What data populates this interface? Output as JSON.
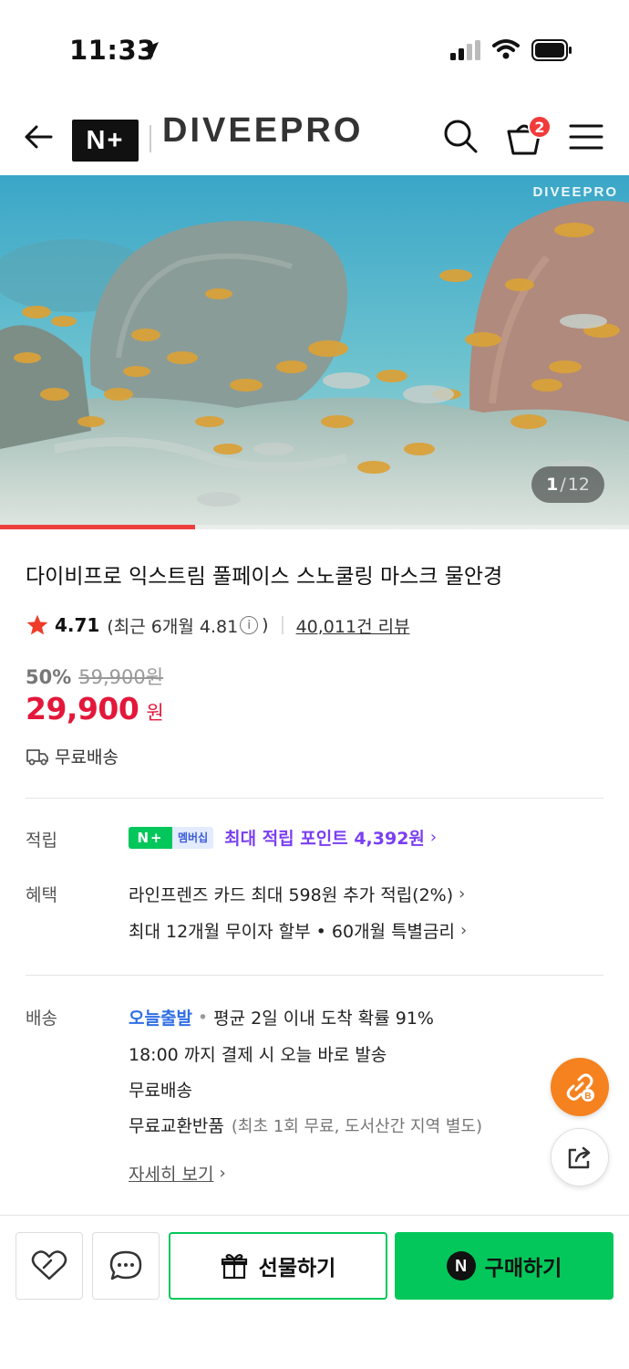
{
  "status_bar": {
    "time": "11:33"
  },
  "header": {
    "nplus_logo": "N+",
    "brand": "DIVEEPRO",
    "cart_count": "2"
  },
  "hero": {
    "watermark": "DIVEEPRO",
    "current_index": "1",
    "total_separator": "/",
    "total": "12",
    "progress_fraction": 0.31
  },
  "product": {
    "title": "다이비프로 익스트림 풀페이스 스노쿨링 마스크 물안경",
    "rating": "4.71",
    "recent_rating_prefix": "(최근 6개월 4.81",
    "recent_rating_suffix": ")",
    "review_count": "40,011건 리뷰",
    "discount": "50%",
    "original_price": "59,900원",
    "price": "29,900",
    "currency": "원",
    "free_shipping": "무료배송"
  },
  "points": {
    "label": "적립",
    "badge_logo": "N+",
    "badge_text": "멤버십",
    "text": "최대 적립 포인트 4,392원"
  },
  "benefits": {
    "label": "혜택",
    "items": [
      "라인프렌즈 카드 최대 598원 추가 적립(2%)",
      "최대 12개월 무이자 할부 • 60개월 특별금리"
    ]
  },
  "delivery": {
    "label": "배송",
    "today": "오늘출발",
    "dot": "•",
    "avg": "평균 2일 이내 도착 확률 91%",
    "cutoff": "18:00 까지 결제 시 오늘 바로 발송",
    "free": "무료배송",
    "exchange": "무료교환반품",
    "exchange_note": "(최초 1회 무료, 도서산간 지역 별도)",
    "detail_link": "자세히 보기"
  },
  "chevron": "›",
  "bottom_bar": {
    "gift_label": "선물하기",
    "buy_logo": "N",
    "buy_label": "구매하기"
  },
  "colors": {
    "price_red": "#e3173a",
    "naver_green": "#03c75a",
    "points_purple": "#7a3ff2",
    "today_blue": "#2f6fe4",
    "fab_orange": "#f5821f"
  },
  "icons": [
    "back-arrow-icon",
    "search-icon",
    "shopping-bag-icon",
    "menu-icon",
    "star-icon",
    "info-icon",
    "truck-icon",
    "link-b-icon",
    "share-icon",
    "heart-icon",
    "chat-icon",
    "gift-icon"
  ]
}
